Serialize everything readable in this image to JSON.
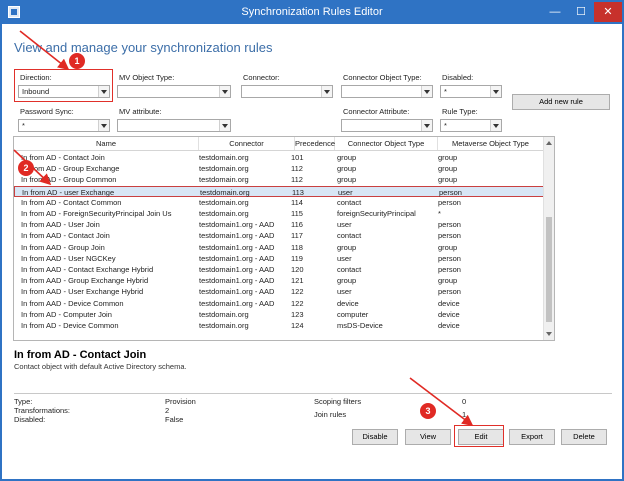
{
  "window": {
    "title": "Synchronization Rules Editor",
    "minimize": "—",
    "maximize": "☐",
    "close": "✕"
  },
  "heading": "View and manage your synchronization rules",
  "filters": {
    "direction": {
      "label": "Direction:",
      "value": "Inbound"
    },
    "mv_object_type": {
      "label": "MV Object Type:",
      "value": ""
    },
    "connector": {
      "label": "Connector:",
      "value": ""
    },
    "connector_object_type": {
      "label": "Connector Object Type:",
      "value": ""
    },
    "disabled": {
      "label": "Disabled:",
      "value": "*"
    },
    "password_sync": {
      "label": "Password Sync:",
      "value": "*"
    },
    "mv_attribute": {
      "label": "MV attribute:",
      "value": ""
    },
    "connector_attribute": {
      "label": "Connector Attribute:",
      "value": ""
    },
    "rule_type": {
      "label": "Rule Type:",
      "value": "*"
    }
  },
  "add_new_rule": "Add new rule",
  "table": {
    "columns": [
      "Name",
      "Connector",
      "Precedence",
      "Connector Object Type",
      "Metaverse Object Type"
    ],
    "rows": [
      [
        "In from AD - Contact Join",
        "testdomain.org",
        "101",
        "group",
        "group"
      ],
      [
        "In from AD - Group Exchange",
        "testdomain.org",
        "112",
        "group",
        "group"
      ],
      [
        "In from AD - Group Common",
        "testdomain.org",
        "112",
        "group",
        "group"
      ],
      [
        "In from AD - user Exchange",
        "testdomain.org",
        "113",
        "user",
        "person"
      ],
      [
        "In from AD - Contact Common",
        "testdomain.org",
        "114",
        "contact",
        "person"
      ],
      [
        "In from AD - ForeignSecurityPrincipal Join Us",
        "testdomain.org",
        "115",
        "foreignSecurityPrincipal",
        "*"
      ],
      [
        "In from AAD - User Join",
        "testdomain1.org - AAD",
        "116",
        "user",
        "person"
      ],
      [
        "In from AAD - Contact Join",
        "testdomain1.org - AAD",
        "117",
        "contact",
        "person"
      ],
      [
        "In from AAD - Group Join",
        "testdomain1.org - AAD",
        "118",
        "group",
        "group"
      ],
      [
        "In from AAD - User NGCKey",
        "testdomain1.org - AAD",
        "119",
        "user",
        "person"
      ],
      [
        "In from AAD - Contact Exchange Hybrid",
        "testdomain1.org - AAD",
        "120",
        "contact",
        "person"
      ],
      [
        "In from AAD - Group Exchange Hybrid",
        "testdomain1.org - AAD",
        "121",
        "group",
        "group"
      ],
      [
        "In from AAD - User Exchange Hybrid",
        "testdomain1.org - AAD",
        "122",
        "user",
        "person"
      ],
      [
        "In from AAD - Device Common",
        "testdomain1.org - AAD",
        "122",
        "device",
        "device"
      ],
      [
        "In from AD - Computer Join",
        "testdomain.org",
        "123",
        "computer",
        "device"
      ],
      [
        "In from AD - Device Common",
        "testdomain.org",
        "124",
        "msDS-Device",
        "device"
      ]
    ],
    "selected_row": 3
  },
  "detail": {
    "title": "In from AD - Contact Join",
    "description": "Contact object with default Active Directory schema.",
    "type_label": "Type:",
    "type_value": "Provision",
    "transformations_label": "Transformations:",
    "transformations_value": "2",
    "disabled_label": "Disabled:",
    "disabled_value": "False",
    "scoping_label": "Scoping filters",
    "scoping_value": "0",
    "join_label": "Join rules",
    "join_value": "1"
  },
  "buttons": {
    "disable": "Disable",
    "view": "View",
    "edit": "Edit",
    "export": "Export",
    "delete": "Delete"
  },
  "annotations": {
    "step1": "1",
    "step2": "2",
    "step3": "3"
  },
  "colors": {
    "titlebar": "#2f73c4",
    "annotation": "#e02a24",
    "heading": "#3c6ea8",
    "selected_row": "#d8e6f5"
  }
}
